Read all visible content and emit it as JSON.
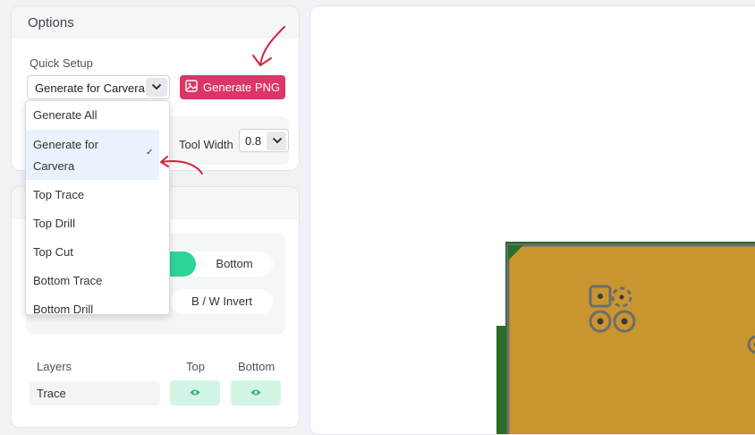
{
  "options": {
    "title": "Options",
    "quick_setup_label": "Quick Setup",
    "quick_setup_value": "Generate for Carvera",
    "generate_png_label": "Generate PNG",
    "tool_width_label": "Tool Width",
    "tool_width_value": "0.8"
  },
  "dropdown": {
    "items": [
      {
        "label": "Generate All"
      },
      {
        "label": "Generate for",
        "label2": "Carvera",
        "selected": true
      },
      {
        "label": "Top Trace"
      },
      {
        "label": "Top Drill"
      },
      {
        "label": "Top Cut"
      },
      {
        "label": "Bottom Trace"
      },
      {
        "label": "Bottom Drill"
      }
    ],
    "check_mark": "✓"
  },
  "layers": {
    "side_bottom_label": "Bottom",
    "invert_label": "B / W Invert",
    "col_layers": "Layers",
    "col_top": "Top",
    "col_bottom": "Bottom",
    "rows": [
      {
        "label": "Trace"
      }
    ]
  },
  "colors": {
    "accent": "#dd3566",
    "toggle_active": "#2ed396",
    "board_copper": "#c9952f",
    "board_edge": "#6d6d6d",
    "board_green": "#2a6e2a",
    "annotation_red": "#d5243c"
  },
  "icons": {
    "chevron": "chevron-down-icon",
    "image": "image-icon",
    "eye": "eye-icon",
    "check": "check-icon"
  }
}
